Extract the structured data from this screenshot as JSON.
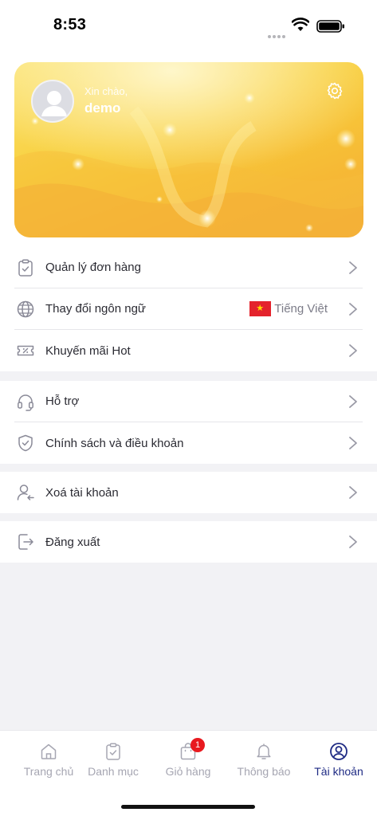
{
  "status_bar": {
    "time": "8:53"
  },
  "profile": {
    "greeting": "Xin chào,",
    "username": "demo",
    "settings_icon": "gear-icon"
  },
  "menu_groups": [
    [
      {
        "label": "Quản lý đơn hàng",
        "icon": "clipboard-check-icon"
      },
      {
        "label": "Thay đổi ngôn ngữ",
        "icon": "globe-icon",
        "value": "Tiếng Việt",
        "flag": "vietnam-flag"
      },
      {
        "label": "Khuyến mãi Hot",
        "icon": "ticket-icon"
      }
    ],
    [
      {
        "label": "Hỗ trợ",
        "icon": "headset-icon"
      },
      {
        "label": "Chính sách và điều khoản",
        "icon": "shield-check-icon"
      }
    ],
    [
      {
        "label": "Xoá tài khoản",
        "icon": "user-remove-icon"
      }
    ],
    [
      {
        "label": "Đăng xuất",
        "icon": "logout-icon"
      }
    ]
  ],
  "tabbar": {
    "items": [
      {
        "label": "Trang chủ",
        "icon": "home-icon",
        "active": false
      },
      {
        "label": "Danh mục",
        "icon": "clipboard-icon",
        "active": false
      },
      {
        "label": "Giỏ hàng",
        "icon": "shopping-bag-icon",
        "active": false,
        "badge": "1"
      },
      {
        "label": "Thông báo",
        "icon": "bell-icon",
        "active": false
      },
      {
        "label": "Tài khoản",
        "icon": "user-circle-icon",
        "active": true
      }
    ]
  },
  "colors": {
    "accent": "#1f2b84",
    "inactive": "#a6a6b2",
    "badge": "#e8191f",
    "hero_start": "#fbe372",
    "hero_end": "#f4b039",
    "background": "#f2f2f5"
  }
}
